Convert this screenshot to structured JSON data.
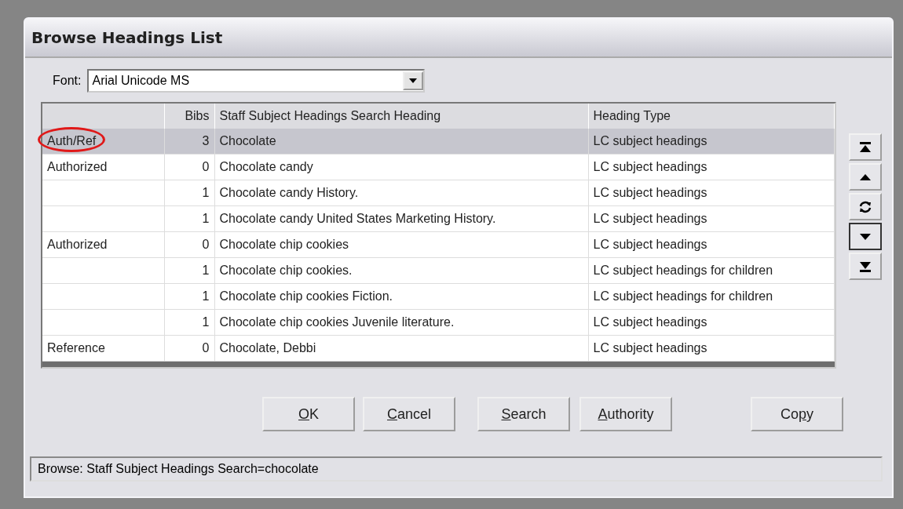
{
  "window": {
    "title": "Browse Headings List"
  },
  "font_select": {
    "label": "Font:",
    "value": "Arial Unicode MS"
  },
  "table": {
    "columns": {
      "bibs": "Bibs",
      "heading": "Staff Subject Headings Search Heading",
      "heading_type": "Heading Type"
    },
    "rows": [
      {
        "status": "Auth/Ref",
        "bibs": "3",
        "heading": "Chocolate",
        "type": "LC subject headings",
        "selected": true,
        "circled": true
      },
      {
        "status": "Authorized",
        "bibs": "0",
        "heading": "Chocolate candy",
        "type": "LC subject headings",
        "selected": false,
        "circled": false
      },
      {
        "bibs": "1",
        "heading": "Chocolate candy History.",
        "type": "LC subject headings",
        "selected": false,
        "circled": false
      },
      {
        "bibs": "1",
        "heading": "Chocolate candy United States Marketing History.",
        "type": "LC subject headings",
        "selected": false,
        "circled": false
      },
      {
        "status": "Authorized",
        "bibs": "0",
        "heading": "Chocolate chip cookies",
        "type": "LC subject headings",
        "selected": false,
        "circled": false
      },
      {
        "bibs": "1",
        "heading": "Chocolate chip cookies.",
        "type": "LC subject headings for children",
        "selected": false,
        "circled": false
      },
      {
        "bibs": "1",
        "heading": "Chocolate chip cookies Fiction.",
        "type": "LC subject headings for children",
        "selected": false,
        "circled": false
      },
      {
        "bibs": "1",
        "heading": "Chocolate chip cookies Juvenile literature.",
        "type": "LC subject headings",
        "selected": false,
        "circled": false
      },
      {
        "status": "Reference",
        "bibs": "0",
        "heading": "Chocolate, Debbi",
        "type": "LC subject headings",
        "selected": false,
        "circled": false
      }
    ]
  },
  "nav_buttons": [
    {
      "kind": "first",
      "focused": false
    },
    {
      "kind": "up",
      "focused": false
    },
    {
      "kind": "refresh",
      "focused": false
    },
    {
      "kind": "down",
      "focused": true
    },
    {
      "kind": "last",
      "focused": false
    }
  ],
  "buttons": [
    {
      "access_key": "O",
      "text_after": "K"
    },
    {
      "access_key": "C",
      "text_after": "ancel"
    },
    {
      "access_key": "S",
      "text_after": "earch"
    },
    {
      "access_key": "A",
      "text_after": "uthority"
    },
    {
      "text_before": "Co",
      "access_key": "p",
      "text_after": "y"
    }
  ],
  "status_bar": "Browse: Staff Subject Headings Search=chocolate"
}
